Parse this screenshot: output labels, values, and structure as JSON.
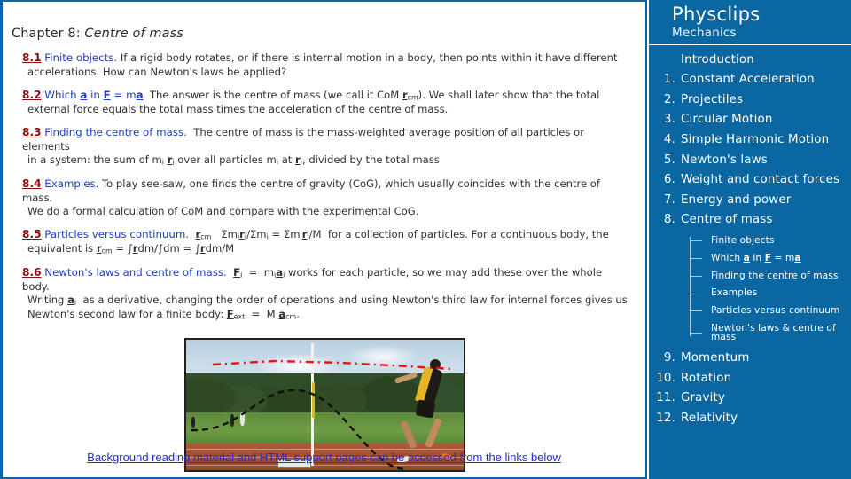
{
  "colors": {
    "sidebar_bg": "#0b67a1",
    "panel_border": "#0e63a8",
    "section_number": "#8a1010",
    "section_title_link": "#1b3fc4",
    "bottom_link": "#2b2bd0",
    "body_text": "#30302f",
    "tree_line": "#9ecbe2"
  },
  "content": {
    "chapter_prefix": "Chapter 8:",
    "chapter_title": "Centre of mass",
    "sections": [
      {
        "number": "8.1",
        "title": "Finite objects.",
        "lines": [
          "If a rigid body rotates, or if there is internal motion in a body, then points within it have different",
          "accelerations. How can Newton's laws be applied?"
        ]
      },
      {
        "number": "8.2",
        "title": "Which a in F = ma",
        "lines": [
          "The answer is the centre of mass (we call it CoM rcm). We shall later show that the total",
          "external force equals the total mass times the acceleration of the centre of mass."
        ]
      },
      {
        "number": "8.3",
        "title": "Finding the centre of mass.",
        "lines": [
          "The centre of mass is the mass-weighted average position of all particles or elements",
          "in a system: the sum of mi ri over all particles mi at ri, divided by the total mass"
        ]
      },
      {
        "number": "8.4",
        "title": "Examples.",
        "lines": [
          "To play see-saw, one finds the centre of gravity (CoG), which usually coincides with the centre of mass.",
          "We do a formal calculation of CoM and compare with the experimental CoG."
        ]
      },
      {
        "number": "8.5",
        "title": "Particles versus continuum.",
        "lines": [
          "rcm  Σmiri/Σmi = Σmiri/M  for a collection of particles. For a continuous body, the",
          "equivalent is rcm = ∫rdm/∫dm = ∫rdm/M"
        ]
      },
      {
        "number": "8.6",
        "title": "Newton's laws and centre of mass.",
        "lines": [
          "Fi  =  miai works for each particle, so we may add these over the whole body.",
          "Writing ai  as a derivative, changing the order of operations and using Newton's third law for internal forces gives us",
          "Newton's second law for a finite body: Fext  =  M acm."
        ]
      }
    ],
    "figure_alt": "High jumper clearing a bar, with dashed red line marking the path of the centre of mass and a dashed black curve marking the path of a body point",
    "bottom_link": "Background reading material and HTML support pages can be accessed from the links below"
  },
  "sidebar": {
    "brand": "Physclips",
    "subtitle": "Mechanics",
    "intro": "Introduction",
    "items": [
      {
        "num": "1.",
        "label": "Constant Acceleration"
      },
      {
        "num": "2.",
        "label": "Projectiles"
      },
      {
        "num": "3.",
        "label": "Circular Motion"
      },
      {
        "num": "4.",
        "label": "Simple Harmonic Motion"
      },
      {
        "num": "5.",
        "label": "Newton's laws"
      },
      {
        "num": "6.",
        "label": "Weight and contact forces"
      },
      {
        "num": "7.",
        "label": "Energy and power"
      },
      {
        "num": "8.",
        "label": "Centre of mass"
      }
    ],
    "subitems": [
      "Finite objects",
      "Which a in F = ma",
      "Finding the centre of mass",
      "Examples",
      "Particles versus continuum",
      "Newton's laws & centre of mass"
    ],
    "items_after": [
      {
        "num": "9.",
        "label": "Momentum"
      },
      {
        "num": "10.",
        "label": "Rotation"
      },
      {
        "num": "11.",
        "label": "Gravity"
      },
      {
        "num": "12.",
        "label": "Relativity"
      }
    ]
  }
}
